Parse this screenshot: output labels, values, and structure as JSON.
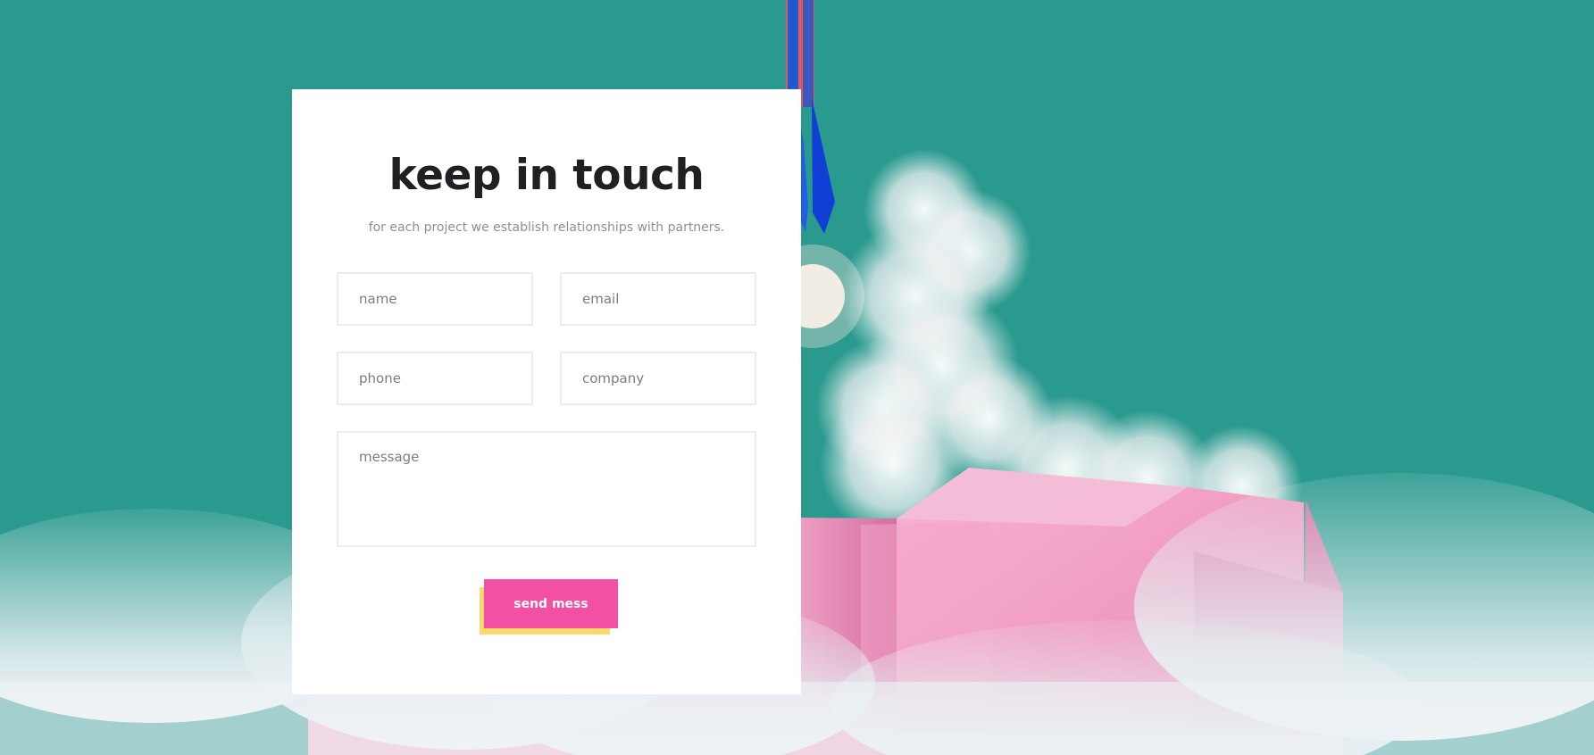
{
  "colors": {
    "accent": "#f450a3",
    "shadow": "#ffd86a",
    "background": "#2a9a8f",
    "card": "#ffffff",
    "title": "#1f1f24",
    "muted": "#8f8f8f"
  },
  "contact": {
    "title": "keep in touch",
    "subtitle": "for each project we establish relationships with partners.",
    "fields": {
      "name": "name",
      "email": "email",
      "phone": "phone",
      "company": "company",
      "message": "message"
    },
    "send_label": "send mess"
  }
}
